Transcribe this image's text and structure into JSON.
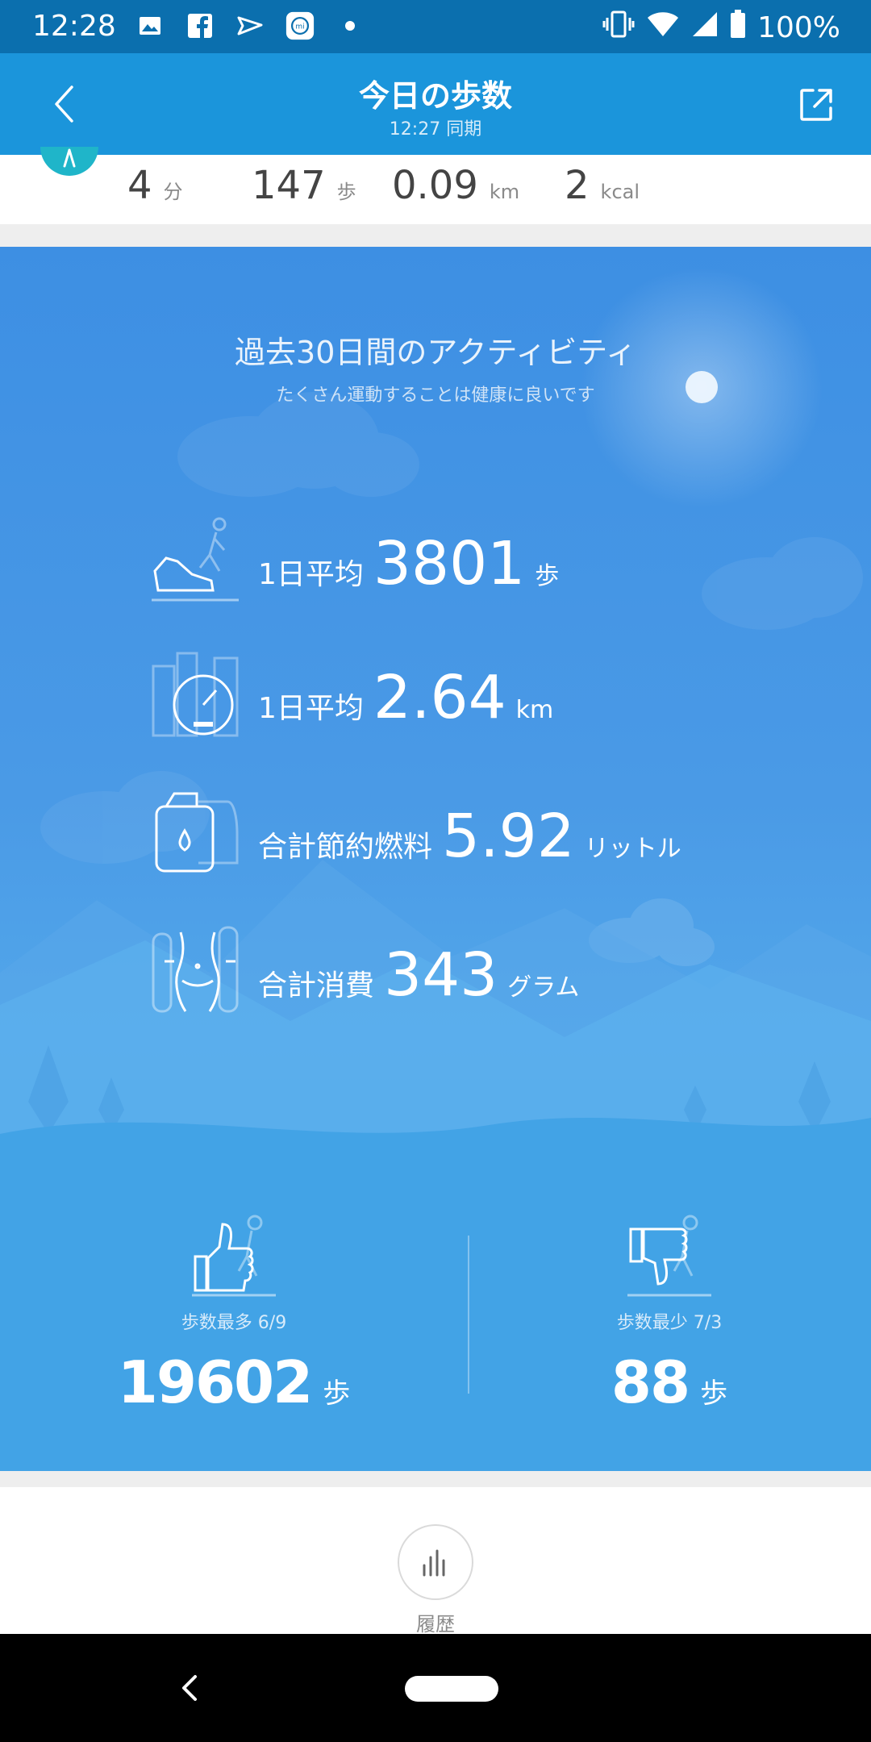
{
  "status_bar": {
    "time": "12:28",
    "battery": "100%"
  },
  "header": {
    "title": "今日の歩数",
    "subtitle": "12:27 同期"
  },
  "summary": [
    {
      "value": "4",
      "unit": "分"
    },
    {
      "value": "147",
      "unit": "歩"
    },
    {
      "value": "0.09",
      "unit": "km"
    },
    {
      "value": "2",
      "unit": "kcal"
    }
  ],
  "activity": {
    "title": "過去30日間のアクティビティ",
    "subtitle": "たくさん運動することは健康に良いです",
    "stats": [
      {
        "label": "1日平均",
        "value": "3801",
        "unit": "歩",
        "icon": "shoe-walker-icon"
      },
      {
        "label": "1日平均",
        "value": "2.64",
        "unit": "km",
        "icon": "speedometer-city-icon"
      },
      {
        "label": "合計節約燃料",
        "value": "5.92",
        "unit": "リットル",
        "icon": "fuel-can-icon"
      },
      {
        "label": "合計消費",
        "value": "343",
        "unit": "グラム",
        "icon": "waist-measure-icon"
      }
    ],
    "most": {
      "label": "歩数最多 6/9",
      "value": "19602",
      "unit": "歩",
      "icon": "thumbs-up-icon"
    },
    "least": {
      "label": "歩数最少 7/3",
      "value": "88",
      "unit": "歩",
      "icon": "thumbs-down-icon"
    }
  },
  "history": {
    "label": "履歴",
    "icon": "bar-chart-icon"
  },
  "colors": {
    "header": "#1b95db",
    "status_bar": "#0b6fae",
    "card": "#4a9ae6",
    "summary_icon": "#1fb5c9"
  }
}
